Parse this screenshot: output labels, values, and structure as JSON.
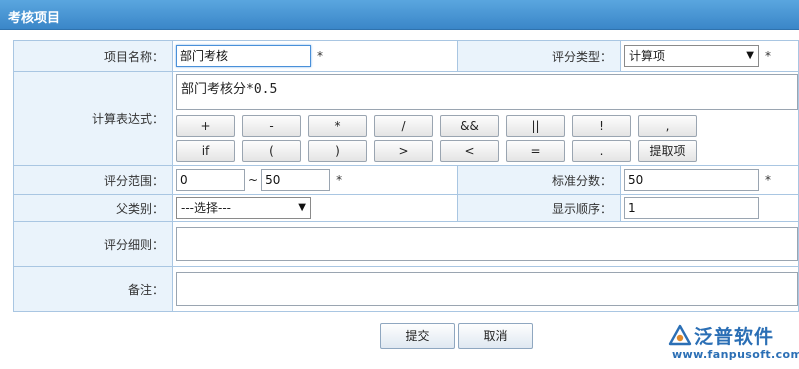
{
  "panel": {
    "title": "考核项目"
  },
  "form": {
    "item_name": {
      "label": "项目名称：",
      "value": "部门考核",
      "required_mark": "*"
    },
    "score_type": {
      "label": "评分类型：",
      "value": "计算项",
      "required_mark": "*"
    },
    "expression": {
      "label": "计算表达式：",
      "value": "部门考核分*0.5",
      "operator_rows": [
        [
          "+",
          "-",
          "*",
          "/",
          "&&",
          "||",
          "!",
          ","
        ],
        [
          "if",
          "(",
          ")",
          ">",
          "<",
          "=",
          ".",
          "提取项"
        ]
      ]
    },
    "score_range": {
      "label": "评分范围：",
      "min": "0",
      "separator": "~",
      "max": "50",
      "required_mark": "*"
    },
    "standard_score": {
      "label": "标准分数：",
      "value": "50",
      "required_mark": "*"
    },
    "parent_category": {
      "label": "父类别：",
      "value": "---选择---"
    },
    "display_order": {
      "label": "显示顺序：",
      "value": "1"
    },
    "scoring_rules": {
      "label": "评分细则：",
      "value": ""
    },
    "remarks": {
      "label": "备注：",
      "value": ""
    }
  },
  "actions": {
    "submit": "提交",
    "cancel": "取消"
  },
  "brand": {
    "name": "泛普软件",
    "url": "www.fanpusoft.com",
    "color": "#2b6fb5"
  }
}
